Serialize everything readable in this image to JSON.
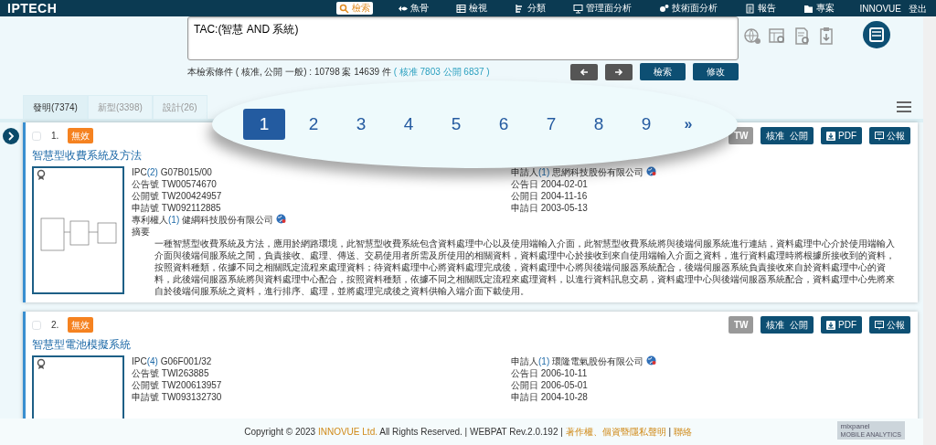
{
  "navbar": {
    "logo": "IPTECH",
    "items": [
      {
        "label": "檢索",
        "selected": true
      },
      {
        "label": "魚骨",
        "selected": false
      },
      {
        "label": "檢視",
        "selected": false
      },
      {
        "label": "分類",
        "selected": false
      },
      {
        "label": "管理面分析",
        "selected": false
      },
      {
        "label": "技術面分析",
        "selected": false
      },
      {
        "label": "報告",
        "selected": false
      },
      {
        "label": "專案",
        "selected": false
      }
    ],
    "user": "INNOVUE",
    "logout": "登出"
  },
  "query": {
    "value": "TAC:(智慧 AND 系統)"
  },
  "summary": {
    "text": "本檢索條件 ( 核准, 公開 一般) : 10798 案  14639 件",
    "link": "( 核准 7803 公開 6837 )"
  },
  "actions": [
    "檢索",
    "修改"
  ],
  "tabs": [
    {
      "label": "發明(7374)",
      "selected": true
    },
    {
      "label": "新型(3398)",
      "selected": false
    },
    {
      "label": "設計(26)",
      "selected": false
    }
  ],
  "pagination": {
    "pages": [
      {
        "label": "1",
        "selected": true
      },
      {
        "label": "2",
        "selected": false
      },
      {
        "label": "3",
        "selected": false
      },
      {
        "label": "4",
        "selected": false
      },
      {
        "label": "5",
        "selected": false
      },
      {
        "label": "6",
        "selected": false
      },
      {
        "label": "7",
        "selected": false
      },
      {
        "label": "8",
        "selected": false
      },
      {
        "label": "9",
        "selected": false
      }
    ],
    "next": "»"
  },
  "results": [
    {
      "number": "1.",
      "checked": false,
      "status": "無效",
      "title": "智慧型收費系統及方法",
      "country": "TW",
      "kinds": "核准  公開",
      "pdf": "PDF",
      "gazette": "公報",
      "left": [
        {
          "label": "IPC",
          "count": "(2)",
          "value": "G07B015/00"
        },
        {
          "label": "公告號",
          "value": "TW00574670"
        },
        {
          "label": "公開號",
          "value": "TW200424957"
        },
        {
          "label": "申請號",
          "value": "TW092112885"
        }
      ],
      "right": [
        {
          "label": "申請人",
          "count": "(1)",
          "value": "思網科技股份有限公司",
          "globe": true
        },
        {
          "label": "公告日",
          "value": "2004-02-01"
        },
        {
          "label": "公開日",
          "value": "2004-11-16"
        },
        {
          "label": "申請日",
          "value": "2003-05-13"
        }
      ],
      "owner": {
        "label": "專利權人",
        "count": "(1)",
        "value": "健綱科技股份有限公司"
      },
      "abstract_label": "摘要",
      "abstract": "一種智慧型收費系統及方法，應用於網路環境，此智慧型收費系統包含資料處理中心以及使用端輸入介面，此智慧型收費系統將與後端伺服系統進行連結，資料處理中心介於使用端輸入介面與後端伺服系統之間，負責接收、處理、傳送、交易使用者所需及所使用的相關資料，資料處理中心於接收到來自使用端輸入介面之資料，進行資料處理時將根據所接收到的資料，按照資料種類，依據不同之相關既定流程來處理資料；待資料處理中心將資料處理完成後，資料處理中心將與後端伺服器系統配合，後端伺服器系統負責接收來自於資料處理中心的資料，此後端伺服器系統將與資料處理中心配合，按照資料種類，依據不同之相關既定流程來處理資料，以進行資料訊息交易，資料處理中心與後端伺服器系統配合，資料處理中心先將來自於後端伺服系統之資料，進行排序、處理，並將處理完成後之資料供輸入端介面下載使用。"
    },
    {
      "number": "2.",
      "checked": false,
      "status": "無效",
      "title": "智慧型電池模擬系統",
      "country": "TW",
      "kinds": "核准  公開",
      "pdf": "PDF",
      "gazette": "公報",
      "left": [
        {
          "label": "IPC",
          "count": "(4)",
          "value": "G06F001/32"
        },
        {
          "label": "公告號",
          "value": "TWI263885"
        },
        {
          "label": "公開號",
          "value": "TW200613957"
        },
        {
          "label": "申請號",
          "value": "TW093132730"
        }
      ],
      "right": [
        {
          "label": "申請人",
          "count": "(1)",
          "value": "環隆電氣股份有限公司",
          "globe": true
        },
        {
          "label": "公告日",
          "value": "2006-10-11"
        },
        {
          "label": "公開日",
          "value": "2006-05-01"
        },
        {
          "label": "申請日",
          "value": "2004-10-28"
        }
      ]
    }
  ],
  "footer": {
    "prefix": "Copyright © 2023",
    "company": "INNOVUE Ltd.",
    "middle": "All Rights Reserved. | WEBPAT Rev.2.0.192 |",
    "privacy": "著作權、個資暨隱私聲明",
    "sep": "|",
    "contact": "聯絡",
    "badge_main": "mixpanel",
    "badge_sub": "MOBILE ANALYTICS"
  }
}
